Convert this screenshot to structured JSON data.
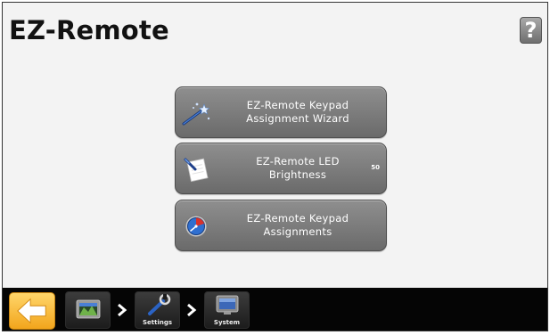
{
  "page": {
    "title": "EZ-Remote",
    "help_label": "?"
  },
  "menu": [
    {
      "label": "EZ-Remote Keypad\nAssignment Wizard",
      "icon": "wizard-wand-icon"
    },
    {
      "label": "EZ-Remote LED\nBrightness",
      "value": "50",
      "icon": "led-brightness-icon"
    },
    {
      "label": "EZ-Remote Keypad\nAssignments",
      "icon": "gauge-dial-icon"
    }
  ],
  "taskbar": {
    "back_icon": "back-arrow-icon",
    "breadcrumb": [
      {
        "label": "",
        "icon": "home-screen-icon"
      },
      {
        "label": "Settings",
        "icon": "wrench-icon"
      },
      {
        "label": "System",
        "icon": "monitor-icon"
      }
    ]
  },
  "colors": {
    "button_top": "#8f8f8f",
    "button_bottom": "#6a6a6a",
    "back_button": "#f2a51c",
    "taskbar": "#050505",
    "background": "#f3f3f3"
  }
}
